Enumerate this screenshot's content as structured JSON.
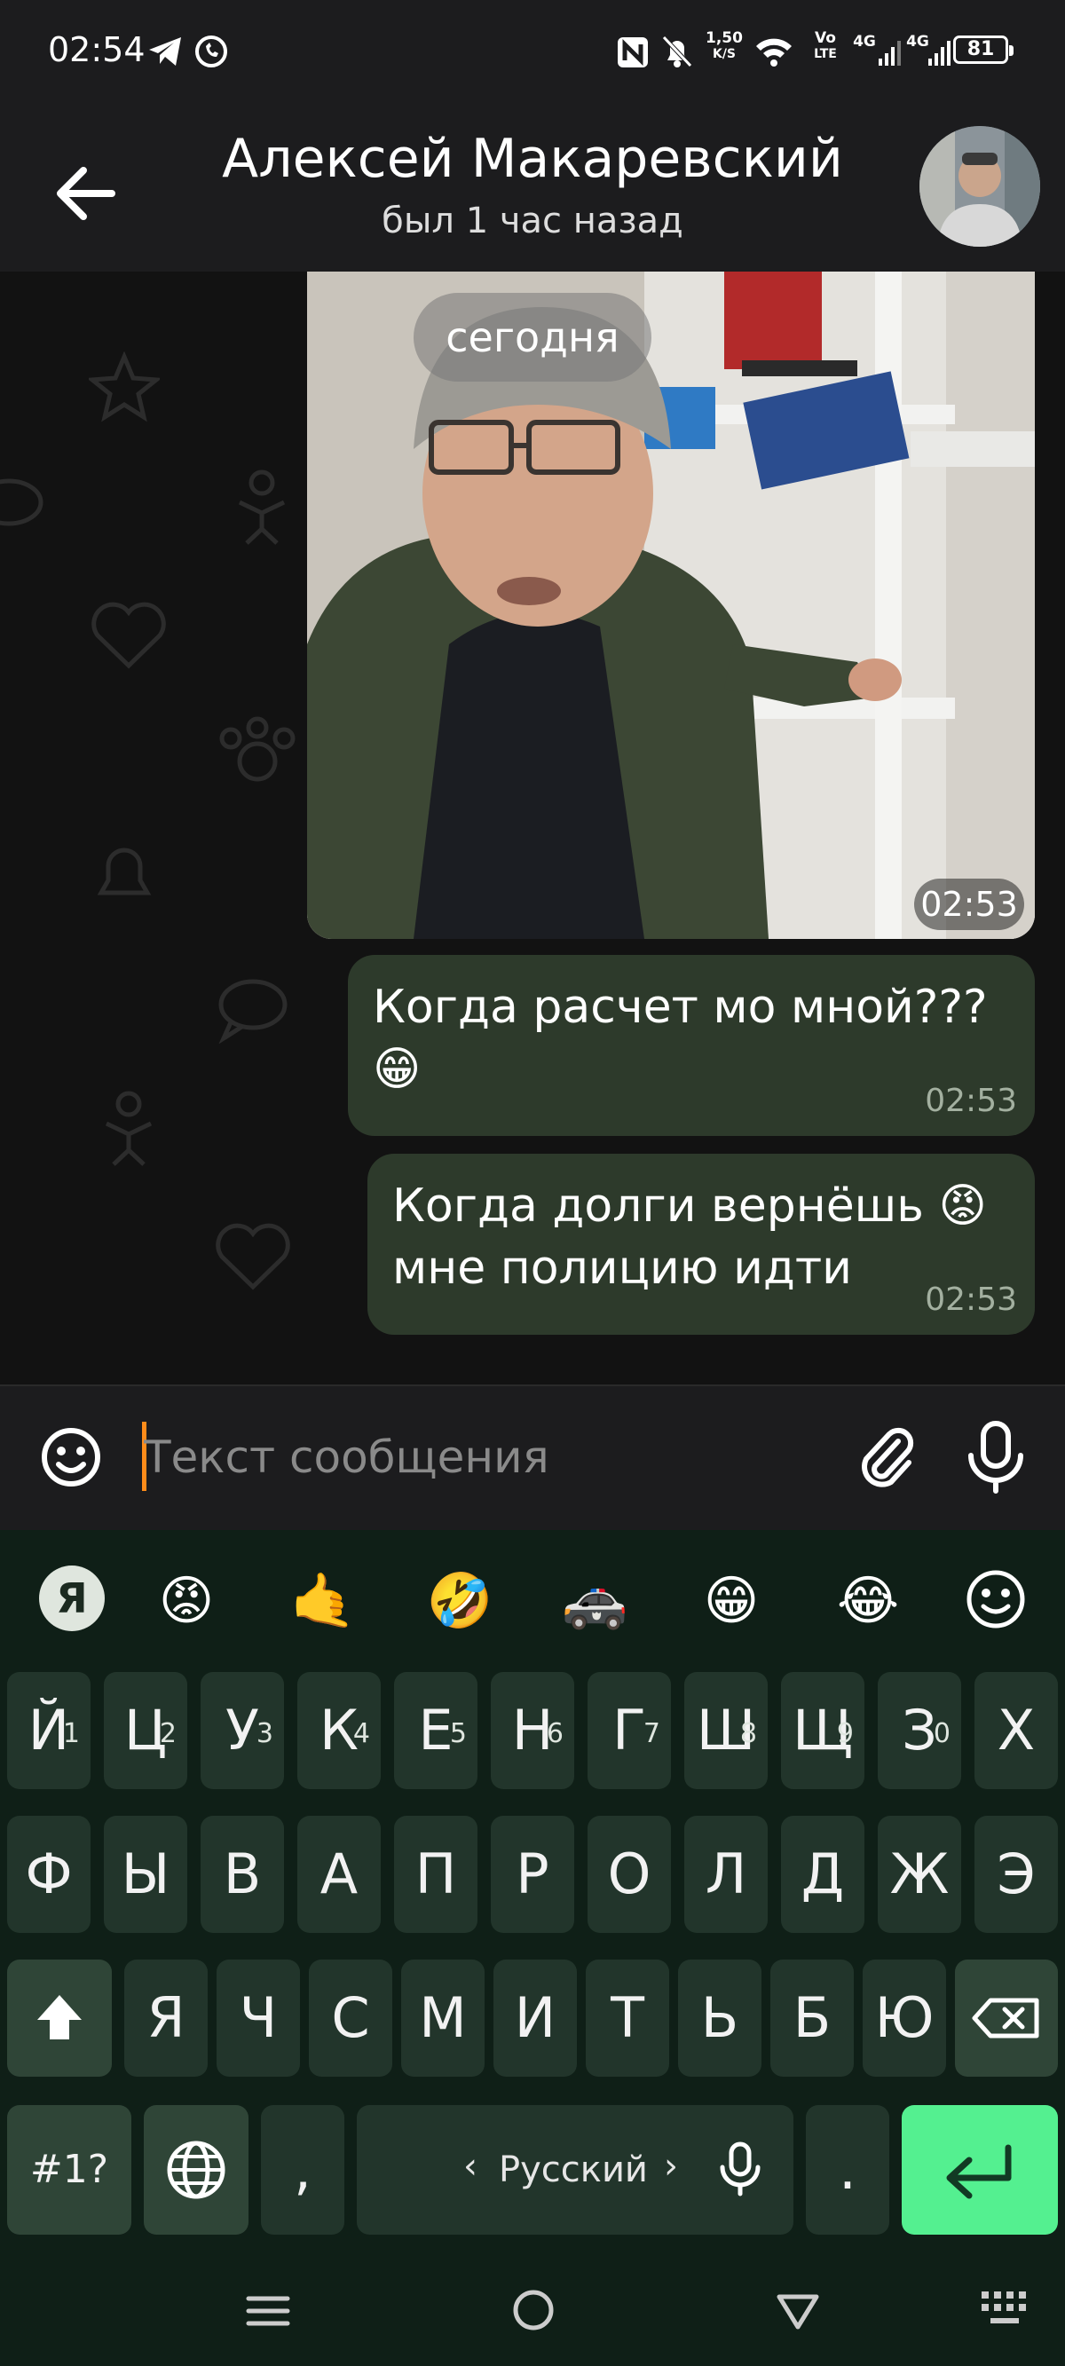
{
  "status_bar": {
    "time": "02:54",
    "speed_value": "1,50",
    "speed_unit": "K/S",
    "volte_top": "Vo",
    "volte_bottom": "LTE",
    "net1": "4G",
    "net2": "4G",
    "battery": "81"
  },
  "header": {
    "contact_name": "Алексей Макаревский",
    "contact_status": "был 1 час назад"
  },
  "chat": {
    "date_pill": "сегодня",
    "video_time": "02:53",
    "messages": [
      {
        "text_line1": "Когда расчет мо мной???",
        "text_line2": "😁",
        "time": "02:53"
      },
      {
        "text_line1": "Когда долги вернёшь 😡",
        "text_line2": "мне полицию идти",
        "time": "02:53"
      }
    ]
  },
  "input": {
    "placeholder": "Текст сообщения"
  },
  "keyboard": {
    "suggestions": [
      "Я",
      "😡",
      "🤙",
      "🤣",
      "🚓",
      "😁",
      "😂"
    ],
    "row1": [
      {
        "label": "Й",
        "hint": "1"
      },
      {
        "label": "Ц",
        "hint": "2"
      },
      {
        "label": "У",
        "hint": "3"
      },
      {
        "label": "К",
        "hint": "4"
      },
      {
        "label": "Е",
        "hint": "5"
      },
      {
        "label": "Н",
        "hint": "6"
      },
      {
        "label": "Г",
        "hint": "7"
      },
      {
        "label": "Ш",
        "hint": "8"
      },
      {
        "label": "Щ",
        "hint": "9"
      },
      {
        "label": "З",
        "hint": "0"
      },
      {
        "label": "Х",
        "hint": ""
      }
    ],
    "row2": [
      "Ф",
      "Ы",
      "В",
      "А",
      "П",
      "Р",
      "О",
      "Л",
      "Д",
      "Ж",
      "Э"
    ],
    "row3": [
      "Я",
      "Ч",
      "С",
      "М",
      "И",
      "Т",
      "Ь",
      "Б",
      "Ю"
    ],
    "symbols_key": "#1?",
    "comma_key": ",",
    "space_label": "Русский",
    "period_key": "."
  },
  "icons": {
    "back": "arrow-left-icon",
    "emoji": "smiley-icon",
    "attach": "paperclip-icon",
    "mic": "microphone-icon",
    "shift": "shift-arrow-icon",
    "backspace": "backspace-icon",
    "globe": "globe-icon",
    "enter": "enter-arrow-icon"
  },
  "colors": {
    "bubble": "#2d3a2b",
    "enter_key": "#54f090",
    "cursor": "#ff8c1a",
    "keyboard_bg": "#0f1f17"
  }
}
